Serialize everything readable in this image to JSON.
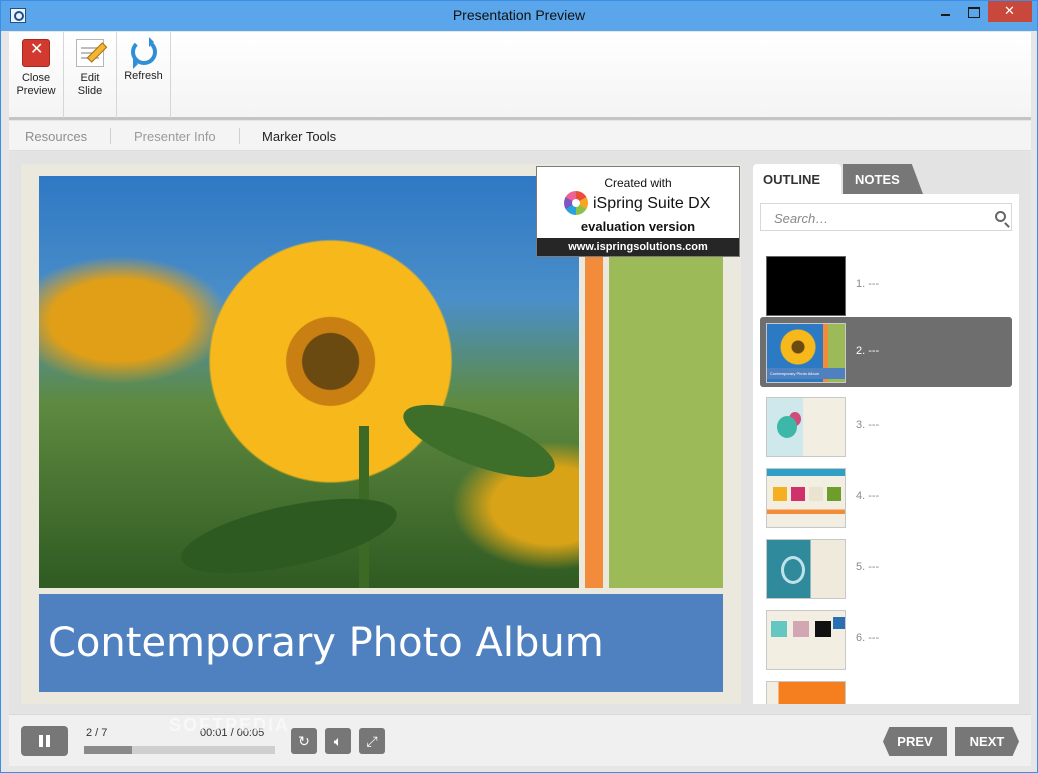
{
  "window": {
    "title": "Presentation Preview"
  },
  "ribbon": {
    "close_label_1": "Close",
    "close_label_2": "Preview",
    "edit_label_1": "Edit",
    "edit_label_2": "Slide",
    "refresh_label": "Refresh"
  },
  "tabs": [
    {
      "label": "Resources",
      "state": "disabled"
    },
    {
      "label": "Presenter Info",
      "state": "disabled"
    },
    {
      "label": "Marker Tools",
      "state": "enabled"
    }
  ],
  "slide": {
    "title": "Contemporary Photo Album"
  },
  "watermark": {
    "created": "Created with",
    "brand": "iSpring Suite DX",
    "eval": "evaluation version",
    "url": "www.ispringsolutions.com"
  },
  "sidebar": {
    "tab_outline": "OUTLINE",
    "tab_notes": "NOTES",
    "search_placeholder": "Search…",
    "slides": [
      {
        "label": "1. ---",
        "thumb": "black"
      },
      {
        "label": "2. ---",
        "thumb": "sunflower",
        "selected": true,
        "thumb_caption": "Contemporary Photo Album"
      },
      {
        "label": "3. ---",
        "thumb": "glassware"
      },
      {
        "label": "4. ---",
        "thumb": "flowers-row"
      },
      {
        "label": "5. ---",
        "thumb": "teal-glass"
      },
      {
        "label": "6. ---",
        "thumb": "collage"
      }
    ]
  },
  "player": {
    "slide_counter": "2 / 7",
    "time": "00:01 / 00:05",
    "progress": 0.25,
    "prev_label": "PREV",
    "next_label": "NEXT",
    "watermark_text": "SOFTPEDIA"
  },
  "colors": {
    "title_bar": "#5ba6ea",
    "slide_title_band": "#4f80bf",
    "accent_orange": "#f28c3a",
    "accent_green": "#9cbb58",
    "selected_item": "#6e6e6e"
  }
}
